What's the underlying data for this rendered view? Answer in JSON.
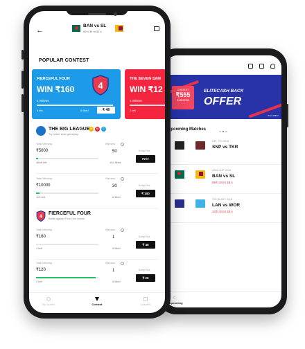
{
  "back_screen": {
    "offer": {
      "coupon_top": "CONTEST",
      "coupon_amount": "₹555",
      "coupon_earn": "EARN₹333",
      "headline": "ELITECASH BACK",
      "title": "OFFER",
      "small_print": "*T&C APPLY"
    },
    "section_title": "Upcoming Matches",
    "matches": [
      {
        "series": "CPL T20 2018",
        "teams": "SNP vs TKR",
        "time": "09 h 34 m 15 s"
      },
      {
        "series": "ASIA CUP 2018",
        "teams": "BAN vs SL",
        "time": "09 h 34 m 15 s"
      },
      {
        "series": "T20 BLAST 2018",
        "teams": "LAN vs WOR",
        "time": "13 h 34 m 15 s"
      }
    ],
    "nav": {
      "upcoming": "Upcoming"
    }
  },
  "header": {
    "match_title": "BAN vs SL",
    "match_time": "09 h 39 m 02 s"
  },
  "popular": {
    "title": "POPULAR CONTEST",
    "cards": [
      {
        "name": "FIERCEFUL FOUR",
        "prize": "WIN ₹160",
        "winners": "1 Winner",
        "left": "4 left",
        "filled": "0 filled",
        "fee": "₹ 48"
      },
      {
        "name": "THE SEVEN SAM",
        "prize": "WIN ₹12",
        "winners": "1 Winner",
        "left": "2 left"
      }
    ]
  },
  "big_league": {
    "name": "THE BIG LEAGUE",
    "subtitle": "Try online slots gameplay",
    "badges": [
      "G",
      "M",
      "C"
    ],
    "contests": [
      {
        "total_label": "Total Winning",
        "total": "₹5000",
        "left": "4848 left",
        "winners_label": "Winners",
        "winners": "50",
        "filled": "152 filled",
        "fee_label": "Entry Fee",
        "fee": "Free",
        "progress": 0.03
      },
      {
        "total_label": "Total Winning",
        "total": "₹10000",
        "left": "119 left",
        "winners_label": "Winners",
        "winners": "30",
        "filled": "6 filled",
        "fee_label": "Entry Fee",
        "fee": "₹ 100",
        "progress": 0.05
      }
    ]
  },
  "fierceful_four": {
    "name": "FIERCEFUL FOUR",
    "subtitle": "Battle against Four One winner",
    "contests": [
      {
        "total_label": "Total Winning",
        "total": "₹160",
        "left": "4 left",
        "winners_label": "Winners",
        "winners": "1",
        "filled": "0 filled",
        "fee_label": "Entry Fee",
        "fee": "₹ 48",
        "progress": 0.0
      },
      {
        "total_label": "Total Winning",
        "total": "₹120",
        "left": "2 left",
        "winners_label": "Winners",
        "winners": "1",
        "filled": "0 filled",
        "fee_label": "Entry Fee",
        "fee": "₹ 20",
        "progress": 0.95
      }
    ]
  },
  "nav": {
    "left": "My Teams",
    "center": "Contest",
    "right": "Leaders"
  },
  "colors": {
    "blue_card": "#1e9be8",
    "red_card": "#f5253f",
    "offer_bg": "#2833a8",
    "progress": "#21c164",
    "timer": "#e5223a"
  }
}
